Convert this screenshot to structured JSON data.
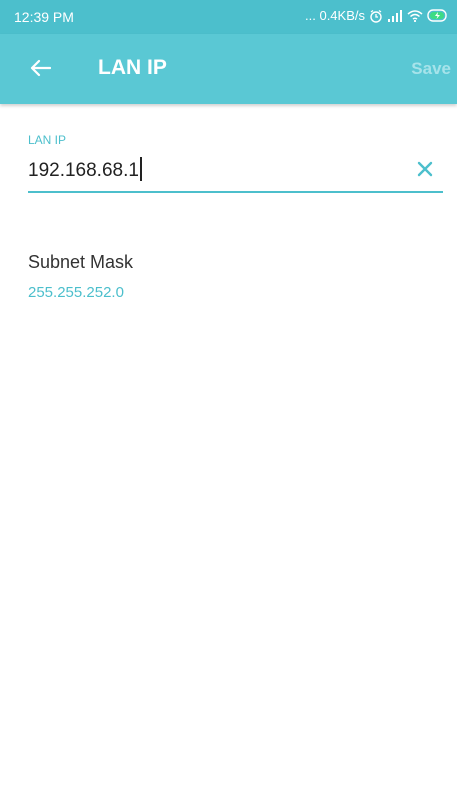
{
  "status_bar": {
    "time": "12:39 PM",
    "network_speed": "... 0.4KB/s",
    "icons": [
      "alarm-icon",
      "signal-icon",
      "wifi-icon",
      "battery-charging-icon"
    ]
  },
  "toolbar": {
    "back_icon": "back-arrow-icon",
    "title": "LAN IP",
    "save_label": "Save"
  },
  "form": {
    "lan_ip": {
      "label": "LAN IP",
      "value": "192.168.68.1",
      "clear_icon": "close-icon"
    },
    "subnet_mask": {
      "label": "Subnet Mask",
      "value": "255.255.252.0"
    }
  },
  "colors": {
    "status_bar": "#4cbfcc",
    "toolbar": "#5ac8d4",
    "accent": "#4cbfcc",
    "save_disabled": "#a6e3ea"
  }
}
